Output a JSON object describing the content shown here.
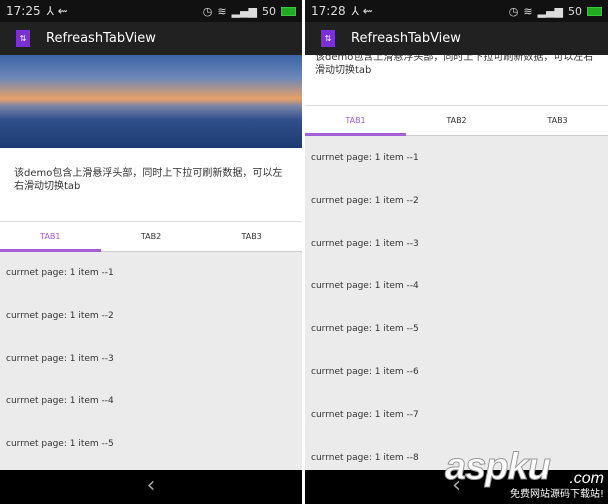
{
  "screens": [
    {
      "time": "17:25",
      "signal": "50"
    },
    {
      "time": "17:28",
      "signal": "50"
    }
  ],
  "app": {
    "title": "RefreashTabView"
  },
  "header": {
    "description": "该demo包含上滑悬浮头部，同时上下拉可刷新数据，可以左右滑动切换tab"
  },
  "tabs": [
    "TAB1",
    "TAB2",
    "TAB3"
  ],
  "list_left": [
    "currnet page: 1 item --1",
    "currnet page: 1 item --2",
    "currnet page: 1 item --3",
    "currnet page: 1 item --4",
    "currnet page: 1 item --5"
  ],
  "list_right": [
    "currnet page: 1 item --1",
    "currnet page: 1 item --2",
    "currnet page: 1 item --3",
    "currnet page: 1 item --4",
    "currnet page: 1 item --5",
    "currnet page: 1 item --6",
    "currnet page: 1 item --7",
    "currnet page: 1 item --8"
  ],
  "nav": {
    "back": "‹"
  },
  "watermark": {
    "logo": "aspku",
    "domain": ".com",
    "tagline": "免费网站源码下载站!"
  },
  "colors": {
    "accent": "#a45fd8",
    "toolbar": "#212121"
  }
}
